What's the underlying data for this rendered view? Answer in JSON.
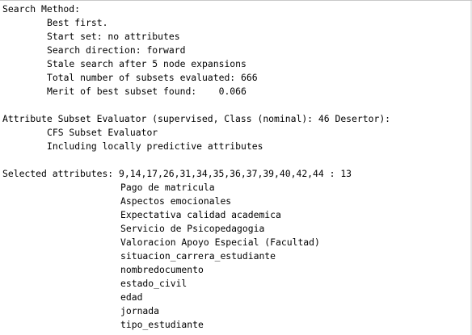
{
  "output": {
    "search_method": {
      "heading": "Search Method:",
      "lines": [
        "Best first.",
        "Start set: no attributes",
        "Search direction: forward",
        "Stale search after 5 node expansions",
        "Total number of subsets evaluated: 666",
        "Merit of best subset found:    0.066"
      ]
    },
    "evaluator": {
      "heading": "Attribute Subset Evaluator (supervised, Class (nominal): 46 Desertor):",
      "lines": [
        "CFS Subset Evaluator",
        "Including locally predictive attributes"
      ]
    },
    "selected": {
      "heading": "Selected attributes: 9,14,17,26,31,34,35,36,37,39,40,42,44 : 13",
      "attributes": [
        "Pago de matricula",
        "Aspectos emocionales",
        "Expectativa calidad academica",
        "Servicio de Psicopedagogia",
        "Valoracion Apoyo Especial (Facultad)",
        "situacion_carrera_estudiante",
        "nombredocumento",
        "estado_civil",
        "edad",
        "jornada",
        "tipo_estudiante"
      ]
    }
  }
}
